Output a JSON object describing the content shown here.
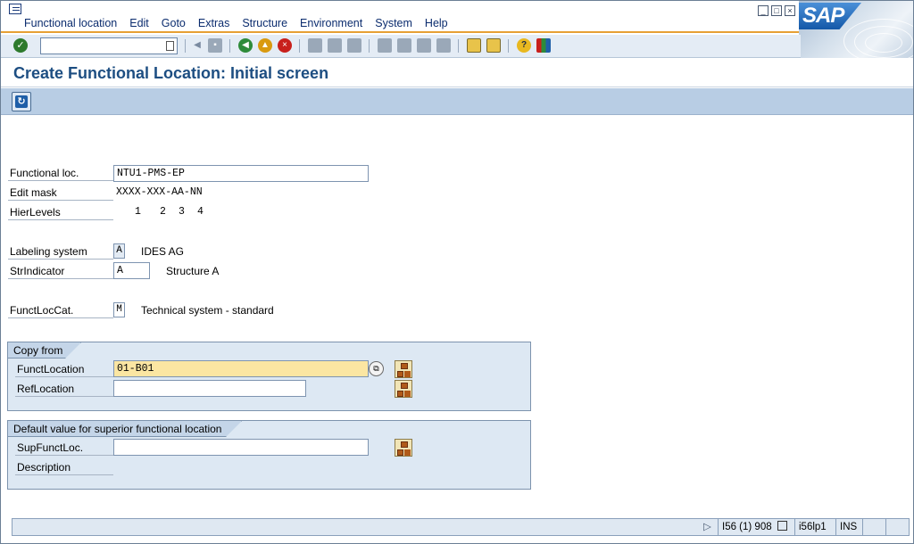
{
  "menu": [
    "Functional location",
    "Edit",
    "Goto",
    "Extras",
    "Structure",
    "Environment",
    "System",
    "Help"
  ],
  "window_buttons": [
    "minimize-icon",
    "restore-icon",
    "close-icon"
  ],
  "brand": "SAP",
  "command_field": {
    "value": ""
  },
  "page_title": "Create Functional Location: Initial screen",
  "fields": {
    "functional_loc": {
      "label": "Functional loc.",
      "value": "NTU1-PMS-EP"
    },
    "edit_mask": {
      "label": "Edit mask",
      "value": "XXXX-XXX-AA-NN"
    },
    "hier_levels": {
      "label": "HierLevels",
      "levels": [
        "1",
        "2",
        "3",
        "4"
      ]
    },
    "labeling_system": {
      "label": "Labeling system",
      "value": "A",
      "description": "IDES AG"
    },
    "str_indicator": {
      "label": "StrIndicator",
      "value": "A",
      "description": "Structure A"
    },
    "funct_loc_cat": {
      "label": "FunctLocCat.",
      "value": "M",
      "description": "Technical system - standard"
    }
  },
  "copy_from": {
    "title": "Copy from",
    "funct_location": {
      "label": "FunctLocation",
      "value": "01-B01"
    },
    "ref_location": {
      "label": "RefLocation",
      "value": ""
    }
  },
  "default_value": {
    "title": "Default value for superior functional location",
    "sup_funct_loc": {
      "label": "SupFunctLoc.",
      "value": ""
    },
    "description": {
      "label": "Description"
    }
  },
  "status": {
    "system": "I56 (1) 908",
    "client": "i56lp1",
    "mode": "INS"
  }
}
